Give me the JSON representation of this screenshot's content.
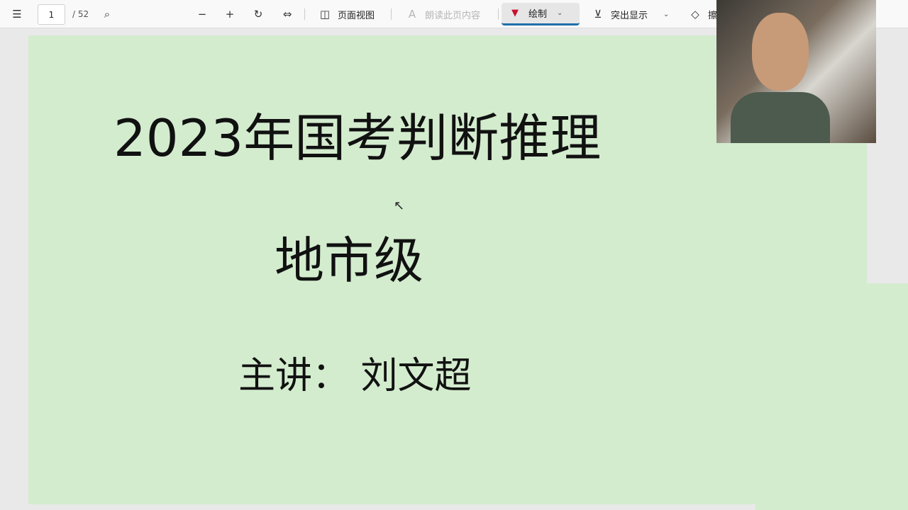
{
  "toolbar": {
    "current_page": "1",
    "total_pages": "/ 52",
    "page_view_label": "页面视图",
    "read_aloud_label": "朗读此页内容",
    "draw_label": "绘制",
    "highlight_label": "突出显示",
    "erase_label": "擦"
  },
  "slide": {
    "title": "2023年国考判断推理",
    "level": "地市级",
    "speaker": "主讲：  刘文超"
  },
  "colors": {
    "page_bg": "#d3ecce",
    "accent": "#1e6fa8"
  }
}
